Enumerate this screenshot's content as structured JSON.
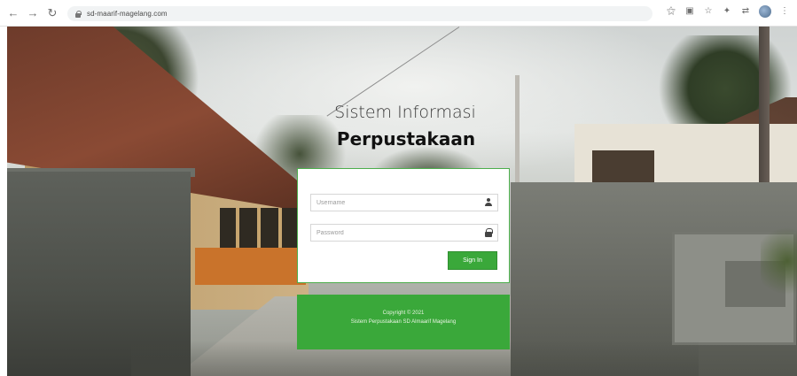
{
  "browser": {
    "url": "sd-maarif-magelang.com",
    "nav_icons": [
      "back-arrow-icon",
      "forward-arrow-icon",
      "reload-icon"
    ],
    "toolbar_icons": [
      "key-icon",
      "cast-icon",
      "star-icon",
      "puzzle-icon",
      "sync-icon",
      "profile-avatar-icon",
      "menu-dots-icon"
    ]
  },
  "login": {
    "title": "Sistem Informasi",
    "subtitle": "Perpustakaan",
    "username_placeholder": "Username",
    "password_placeholder": "Password",
    "signin_label": "Sign In"
  },
  "footer": {
    "copyright": "Copyright © 2021",
    "organization": "Sistem Perpustakaan SD Almaarif Magelang"
  },
  "colors": {
    "accent_green": "#3aa83a",
    "card_border": "#4cae4c"
  }
}
